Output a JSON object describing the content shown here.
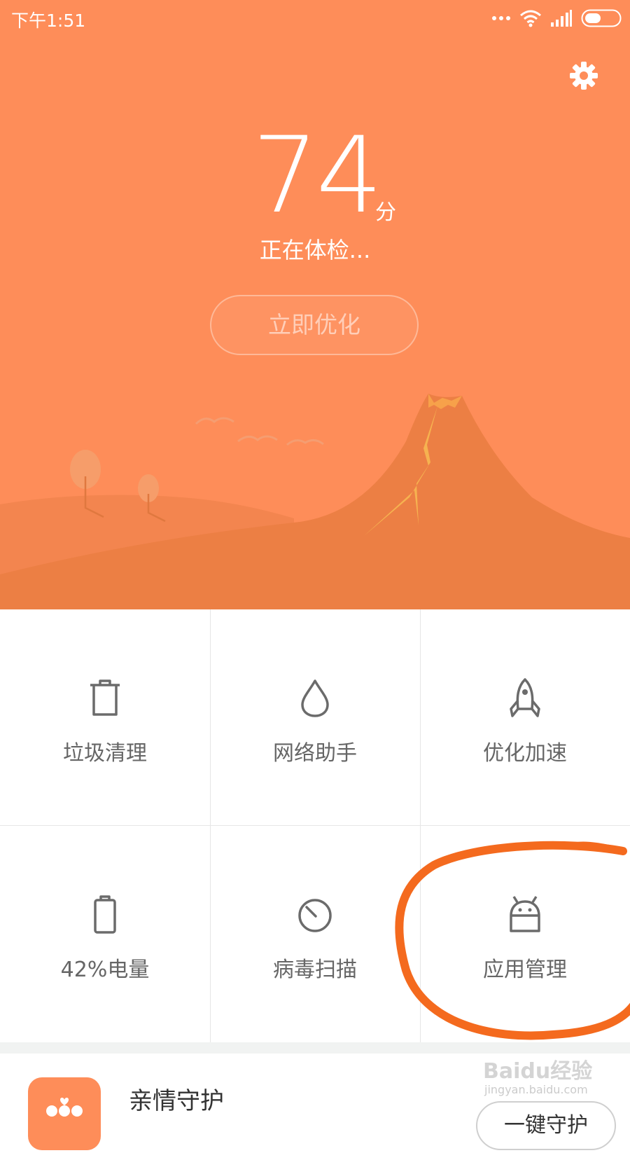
{
  "status_bar": {
    "time": "下午1:51"
  },
  "score": {
    "value": "74",
    "unit": "分",
    "status": "正在体检..."
  },
  "optimize_button": "立即优化",
  "grid": [
    {
      "label": "垃圾清理",
      "icon": "trash-icon"
    },
    {
      "label": "网络助手",
      "icon": "water-drop-icon"
    },
    {
      "label": "优化加速",
      "icon": "rocket-icon"
    },
    {
      "label": "42%电量",
      "icon": "battery-icon"
    },
    {
      "label": "病毒扫描",
      "icon": "virus-scan-icon"
    },
    {
      "label": "应用管理",
      "icon": "android-icon"
    }
  ],
  "family_card": {
    "title": "亲情守护",
    "button": "一键守护"
  },
  "watermark": {
    "text": "Baidu经验",
    "sub": "jingyan.baidu.com"
  },
  "colors": {
    "accent": "#FE8D59",
    "annotation": "#F46A1E"
  }
}
